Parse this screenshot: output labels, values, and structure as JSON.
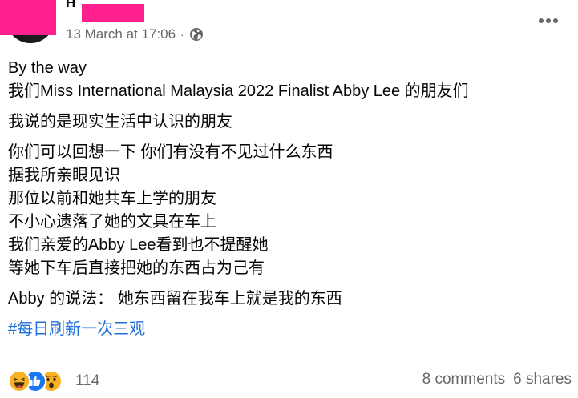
{
  "header": {
    "author_name": "H",
    "timestamp": "13 March at 17:06",
    "separator": "·",
    "audience_icon": "globe-icon",
    "more_icon": "more-options-icon"
  },
  "post": {
    "lines": [
      "By the way",
      "我们Miss International Malaysia 2022 Finalist Abby Lee 的朋友们",
      "我说的是现实生活中认识的朋友",
      "你们可以回想一下 你们有没有不见过什么东西",
      "据我所亲眼见识",
      "那位以前和她共车上学的朋友",
      "不小心遗落了她的文具在车上",
      "我们亲爱的Abby Lee看到也不提醒她",
      "等她下车后直接把她的东西占为己有",
      "Abby 的说法： 她东西留在我车上就是我的东西"
    ],
    "hashtag": "#每日刷新一次三观"
  },
  "footer": {
    "reaction_icons": [
      "haha-icon",
      "like-icon",
      "wow-icon"
    ],
    "reaction_count": "114",
    "comments": "8 comments",
    "shares": "6 shares"
  },
  "colors": {
    "redaction": "#ff1f8e",
    "meta_text": "#65676b",
    "hashtag": "#216fdb",
    "like_blue": "#1877f2",
    "emoji_yellow": "#f7b125"
  }
}
